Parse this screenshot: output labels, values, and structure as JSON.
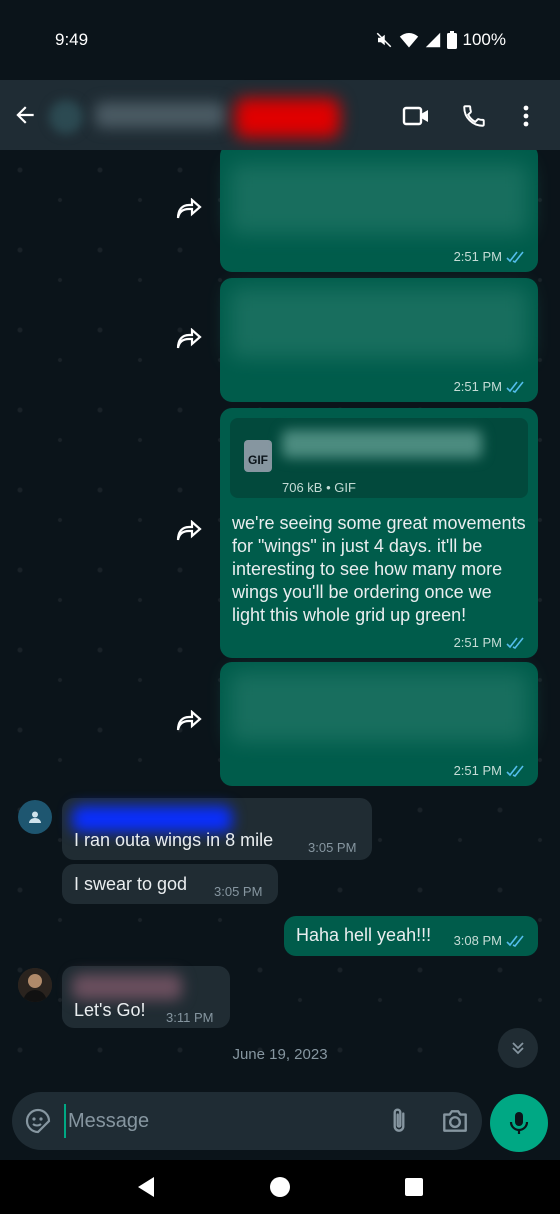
{
  "status_bar": {
    "time": "9:49",
    "battery": "100%"
  },
  "header": {
    "back_icon": "arrow-left-icon",
    "video_icon": "video-camera-icon",
    "call_icon": "phone-icon",
    "menu_icon": "more-vertical-icon"
  },
  "messages": {
    "out1_time": "2:51 PM",
    "out2_time": "2:51 PM",
    "gif_meta": "706 kB • GIF",
    "gif_badge": "GIF",
    "out3_text": "we're seeing some great movements for \"wings\" in just 4 days. it'll be interesting to see how many more wings you'll be ordering once we light this whole grid up green!",
    "out3_time": "2:51 PM",
    "out4_time": "2:51 PM",
    "in1_text": "I ran outa wings in 8 mile",
    "in1_time": "3:05 PM",
    "in2_text": "I swear to god",
    "in2_time": "3:05 PM",
    "out5_text": "Haha hell yeah!!!",
    "out5_time": "3:08 PM",
    "in3_text": "Let's Go!",
    "in3_time": "3:11 PM"
  },
  "date_divider": "June 19, 2023",
  "composer": {
    "placeholder": "Message"
  },
  "colors": {
    "outgoing_bubble": "#005c4b",
    "incoming_bubble": "#202c33",
    "accent": "#00a884",
    "read_ticks": "#53bdeb"
  }
}
